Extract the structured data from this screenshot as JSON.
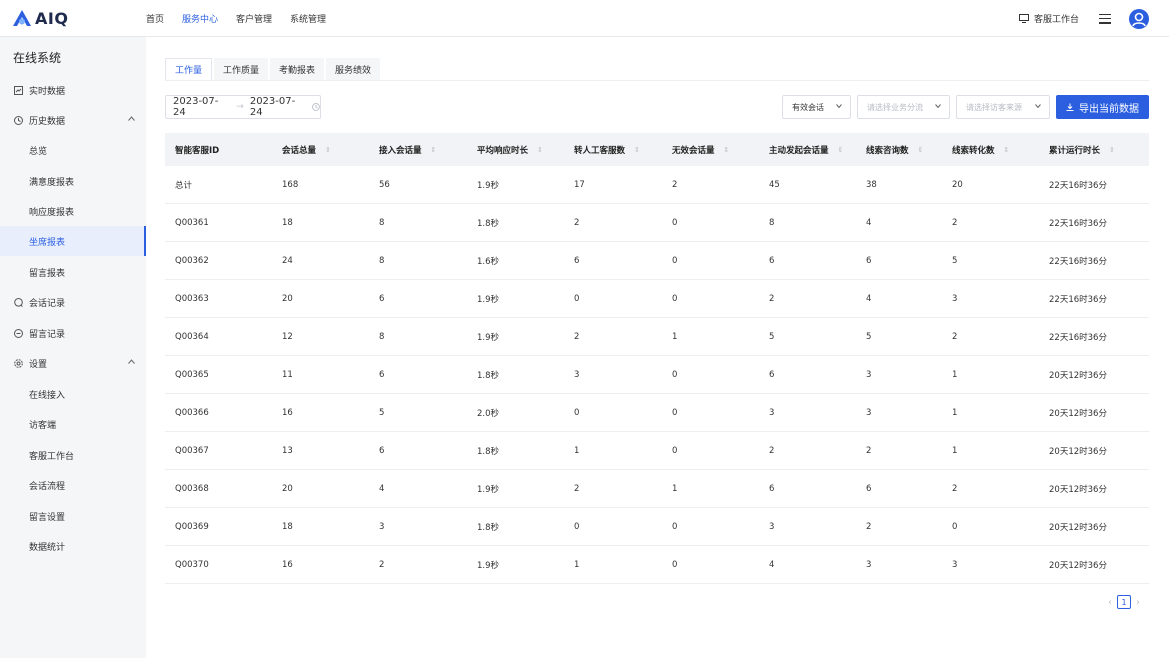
{
  "brand": {
    "logo_text": "AIQ",
    "accent": "#2b5fe0"
  },
  "topnav": [
    {
      "label": "首页",
      "active": false
    },
    {
      "label": "服务中心",
      "active": true
    },
    {
      "label": "客户管理",
      "active": false
    },
    {
      "label": "系统管理",
      "active": false
    }
  ],
  "topright": {
    "workbench_label": "客服工作台"
  },
  "sidebar": {
    "title": "在线系统",
    "items": [
      {
        "label": "实时数据",
        "icon": "chart-box-icon"
      },
      {
        "label": "历史数据",
        "icon": "clock-icon",
        "expanded": true
      },
      {
        "label": "总览"
      },
      {
        "label": "满意度报表"
      },
      {
        "label": "响应度报表"
      },
      {
        "label": "坐席报表",
        "active": true
      },
      {
        "label": "留言报表"
      },
      {
        "label": "会话记录",
        "icon": "chat-icon"
      },
      {
        "label": "留言记录",
        "icon": "message-icon"
      },
      {
        "label": "设置",
        "icon": "gear-icon",
        "expanded": true
      },
      {
        "label": "在线接入"
      },
      {
        "label": "访客端"
      },
      {
        "label": "客服工作台"
      },
      {
        "label": "会话流程"
      },
      {
        "label": "留言设置"
      },
      {
        "label": "数据统计"
      }
    ]
  },
  "tabs": [
    {
      "label": "工作量",
      "active": true
    },
    {
      "label": "工作质量"
    },
    {
      "label": "考勤报表"
    },
    {
      "label": "服务绩效"
    }
  ],
  "filters": {
    "date_start": "2023-07-24",
    "date_sep": "→",
    "date_end": "2023-07-24",
    "session_type": "有效会话",
    "business_placeholder": "请选择业务分流",
    "source_placeholder": "请选择访客来源",
    "export_label": "导出当前数据"
  },
  "table": {
    "columns": [
      "智能客服ID",
      "会话总量",
      "接入会话量",
      "平均响应时长",
      "转人工客服数",
      "无效会话量",
      "主动发起会话量",
      "线索咨询数",
      "线索转化数",
      "累计运行时长"
    ],
    "rows": [
      [
        "总计",
        "168",
        "56",
        "1.9秒",
        "17",
        "2",
        "45",
        "38",
        "20",
        "22天16时36分"
      ],
      [
        "Q00361",
        "18",
        "8",
        "1.8秒",
        "2",
        "0",
        "8",
        "4",
        "2",
        "22天16时36分"
      ],
      [
        "Q00362",
        "24",
        "8",
        "1.6秒",
        "6",
        "0",
        "6",
        "6",
        "5",
        "22天16时36分"
      ],
      [
        "Q00363",
        "20",
        "6",
        "1.9秒",
        "0",
        "0",
        "2",
        "4",
        "3",
        "22天16时36分"
      ],
      [
        "Q00364",
        "12",
        "8",
        "1.9秒",
        "2",
        "1",
        "5",
        "5",
        "2",
        "22天16时36分"
      ],
      [
        "Q00365",
        "11",
        "6",
        "1.8秒",
        "3",
        "0",
        "6",
        "3",
        "1",
        "20天12时36分"
      ],
      [
        "Q00366",
        "16",
        "5",
        "2.0秒",
        "0",
        "0",
        "3",
        "3",
        "1",
        "20天12时36分"
      ],
      [
        "Q00367",
        "13",
        "6",
        "1.8秒",
        "1",
        "0",
        "2",
        "2",
        "1",
        "20天12时36分"
      ],
      [
        "Q00368",
        "20",
        "4",
        "1.9秒",
        "2",
        "1",
        "6",
        "6",
        "2",
        "20天12时36分"
      ],
      [
        "Q00369",
        "18",
        "3",
        "1.8秒",
        "0",
        "0",
        "3",
        "2",
        "0",
        "20天12时36分"
      ],
      [
        "Q00370",
        "16",
        "2",
        "1.9秒",
        "1",
        "0",
        "4",
        "3",
        "3",
        "20天12时36分"
      ]
    ]
  },
  "pagination": {
    "current": "1"
  }
}
